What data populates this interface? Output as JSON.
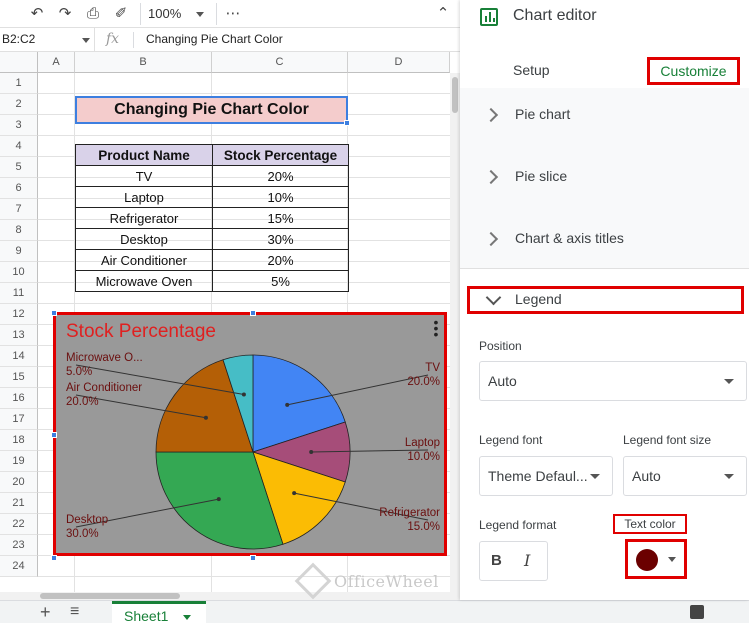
{
  "toolbar": {
    "zoom": "100%"
  },
  "formula_bar": {
    "name_box": "B2:C2",
    "fx": "fx",
    "formula": "Changing Pie Chart Color"
  },
  "columns": [
    "A",
    "B",
    "C",
    "D"
  ],
  "rows": [
    "1",
    "2",
    "3",
    "4",
    "5",
    "6",
    "7",
    "8",
    "9",
    "10",
    "11",
    "12",
    "13",
    "14",
    "15",
    "16",
    "17",
    "18",
    "19",
    "20",
    "21",
    "22",
    "23",
    "24"
  ],
  "sheet": {
    "title_cell": "Changing Pie Chart Color",
    "table": {
      "headers": [
        "Product Name",
        "Stock Percentage"
      ],
      "rows": [
        [
          "TV",
          "20%"
        ],
        [
          "Laptop",
          "10%"
        ],
        [
          "Refrigerator",
          "15%"
        ],
        [
          "Desktop",
          "30%"
        ],
        [
          "Air Conditioner",
          "20%"
        ],
        [
          "Microwave Oven",
          "5%"
        ]
      ]
    }
  },
  "chart_data": {
    "type": "pie",
    "title": "Stock Percentage",
    "categories": [
      "TV",
      "Laptop",
      "Refrigerator",
      "Desktop",
      "Air Conditioner",
      "Microwave Oven"
    ],
    "values": [
      20,
      10,
      15,
      30,
      20,
      5
    ],
    "labels": [
      {
        "name": "TV",
        "pct": "20.0%"
      },
      {
        "name": "Laptop",
        "pct": "10.0%"
      },
      {
        "name": "Refrigerator",
        "pct": "15.0%"
      },
      {
        "name": "Desktop",
        "pct": "30.0%"
      },
      {
        "name": "Air Conditioner",
        "pct": "20.0%"
      },
      {
        "name": "Microwave O...",
        "pct": "5.0%"
      }
    ],
    "colors": [
      "#4285f4",
      "#a64d79",
      "#fbbc04",
      "#34a853",
      "#b45f06",
      "#46bdc6"
    ],
    "background": "#999999",
    "title_color": "#e02020",
    "label_color": "#6b0f0f",
    "legend_position": "auto"
  },
  "sheet_tabs": {
    "active": "Sheet1"
  },
  "editor": {
    "title": "Chart editor",
    "tabs": {
      "setup": "Setup",
      "customize": "Customize"
    },
    "sections": [
      "Pie chart",
      "Pie slice",
      "Chart & axis titles"
    ],
    "legend": {
      "header": "Legend",
      "position_label": "Position",
      "position_value": "Auto",
      "font_label": "Legend font",
      "font_value": "Theme Defaul...",
      "font_size_label": "Legend font size",
      "font_size_value": "Auto",
      "format_label": "Legend format",
      "bold": "B",
      "italic": "I",
      "text_color_label": "Text color",
      "text_color_value": "#6b0000"
    }
  },
  "watermark": "OfficeWheel"
}
